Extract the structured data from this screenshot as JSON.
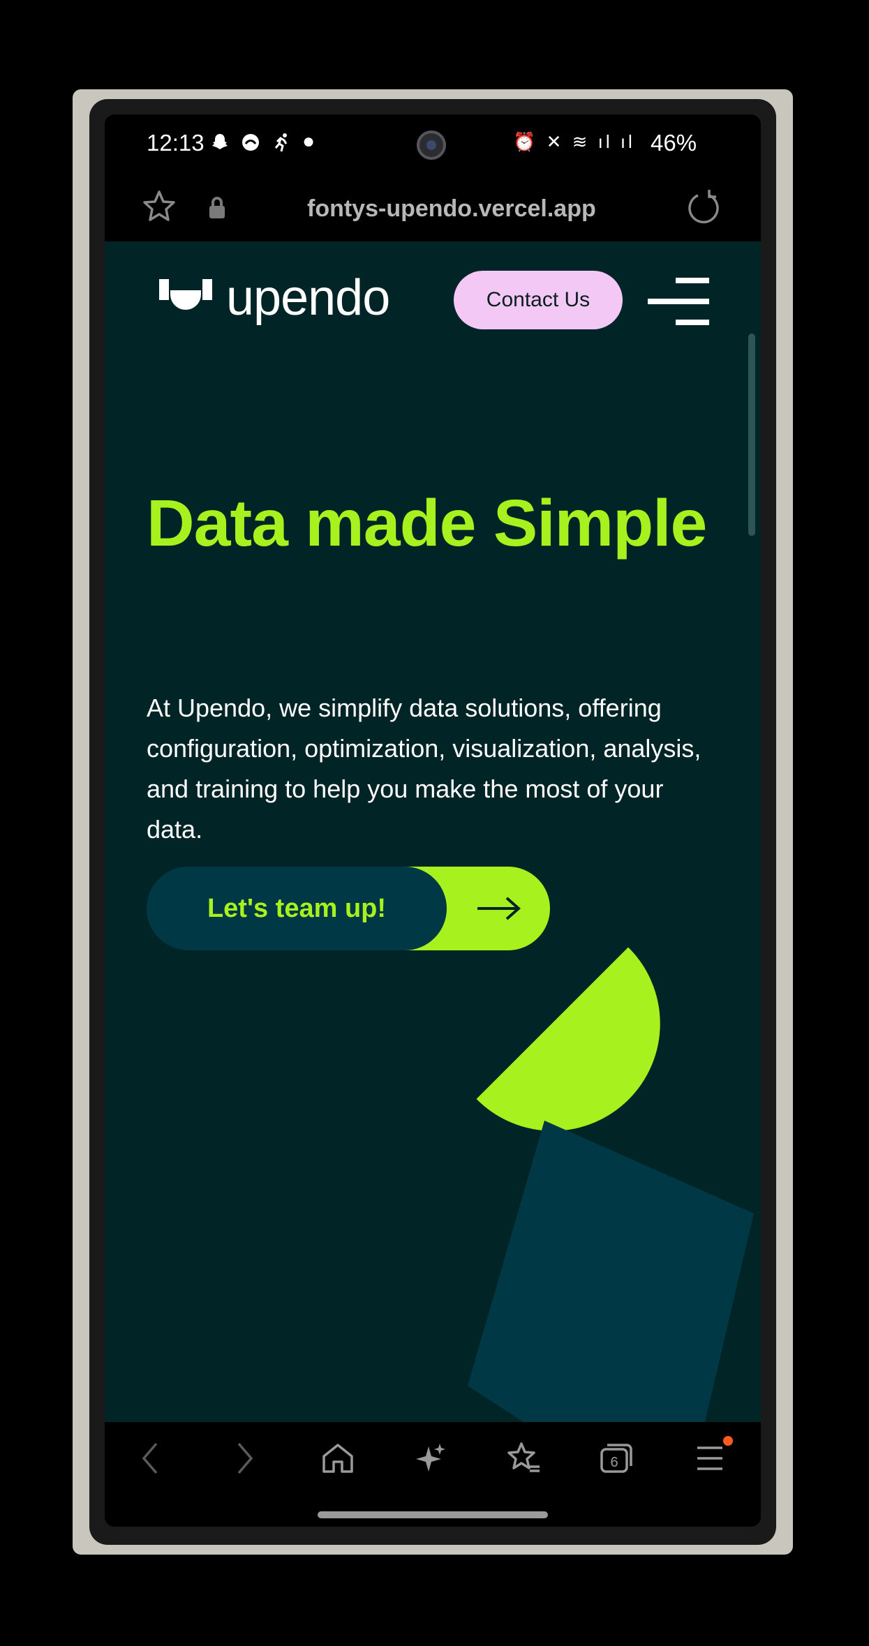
{
  "status_bar": {
    "time": "12:13",
    "left_icons": "●",
    "right_icons": "⏰ ✕ ≋ ıl ıl",
    "battery": "46%"
  },
  "address_bar": {
    "url": "fontys-upendo.vercel.app"
  },
  "site": {
    "logo_text": "upendo",
    "contact_label": "Contact Us",
    "headline": "Data made Simple",
    "lead": "At Upendo, we simplify data solutions, offering configuration, optimization, visualization, analysis, and training to help you make the most of your data.",
    "cta_label": "Let's team up!"
  },
  "toolbar": {
    "tabs_count": "6",
    "items": [
      "back",
      "forward",
      "home",
      "assistant",
      "bookmarks",
      "tabs",
      "menu"
    ]
  },
  "colors": {
    "page_bg": "#012526",
    "accent_green": "#a6f11e",
    "accent_pink": "#f4c8f4",
    "deep_teal": "#003845",
    "notification_dot": "#ff5a1f"
  }
}
